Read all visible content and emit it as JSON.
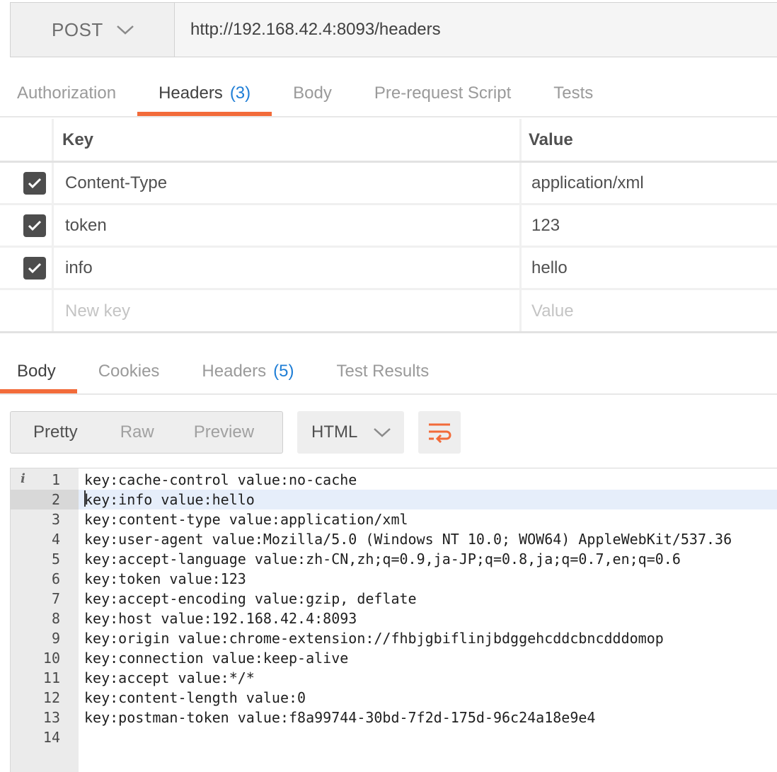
{
  "request": {
    "method": "POST",
    "url": "http://192.168.42.4:8093/headers"
  },
  "request_tabs": [
    {
      "label": "Authorization",
      "count": ""
    },
    {
      "label": "Headers",
      "count": "(3)"
    },
    {
      "label": "Body",
      "count": ""
    },
    {
      "label": "Pre-request Script",
      "count": ""
    },
    {
      "label": "Tests",
      "count": ""
    }
  ],
  "headers_table": {
    "columns": {
      "key": "Key",
      "value": "Value"
    },
    "rows": [
      {
        "key": "Content-Type",
        "value": "application/xml",
        "checked": true
      },
      {
        "key": "token",
        "value": "123",
        "checked": true
      },
      {
        "key": "info",
        "value": "hello",
        "checked": true
      }
    ],
    "new_row": {
      "key_placeholder": "New key",
      "value_placeholder": "Value"
    }
  },
  "response_tabs": [
    {
      "label": "Body",
      "count": ""
    },
    {
      "label": "Cookies",
      "count": ""
    },
    {
      "label": "Headers",
      "count": "(5)"
    },
    {
      "label": "Test Results",
      "count": ""
    }
  ],
  "response_view": {
    "modes": [
      "Pretty",
      "Raw",
      "Preview"
    ],
    "active_mode": "Pretty",
    "format": "HTML",
    "wrap_icon": "wrap-lines-icon"
  },
  "code_lines": [
    {
      "n": "1",
      "text": "key:cache-control value:no-cache"
    },
    {
      "n": "2",
      "text": "key:info value:hello"
    },
    {
      "n": "3",
      "text": "key:content-type value:application/xml"
    },
    {
      "n": "4",
      "text": "key:user-agent value:Mozilla/5.0 (Windows NT 10.0; WOW64) AppleWebKit/537.36"
    },
    {
      "n": "5",
      "text": "key:accept-language value:zh-CN,zh;q=0.9,ja-JP;q=0.8,ja;q=0.7,en;q=0.6"
    },
    {
      "n": "6",
      "text": "key:token value:123"
    },
    {
      "n": "7",
      "text": "key:accept-encoding value:gzip, deflate"
    },
    {
      "n": "8",
      "text": "key:host value:192.168.42.4:8093"
    },
    {
      "n": "9",
      "text": "key:origin value:chrome-extension://fhbjgbiflinjbdggehcddcbncdddomop"
    },
    {
      "n": "10",
      "text": "key:connection value:keep-alive"
    },
    {
      "n": "11",
      "text": "key:accept value:*/*"
    },
    {
      "n": "12",
      "text": "key:content-length value:0"
    },
    {
      "n": "13",
      "text": "key:postman-token value:f8a99744-30bd-7f2d-175d-96c24a18e9e4"
    },
    {
      "n": "14",
      "text": ""
    }
  ],
  "colors": {
    "accent": "#f26b3a",
    "count": "#1f7ed6",
    "checkbox": "#4d4d4d"
  }
}
